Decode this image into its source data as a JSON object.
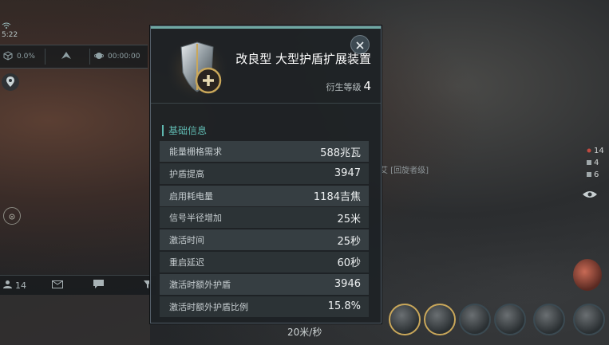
{
  "hud": {
    "time": "5:22",
    "cell1_value": "0.0%",
    "cell3_value": "00:00:00"
  },
  "chat": {
    "members_count": "14"
  },
  "right_counts": [
    "14",
    "4",
    "6"
  ],
  "pilot_label": "艾 [回旋者级]",
  "speed": "20米/秒",
  "panel": {
    "item_name": "改良型 大型护盾扩展装置",
    "level_label": "衍生等级",
    "level_value": "4",
    "section_title": "基础信息",
    "stats": [
      {
        "label": "能量栅格需求",
        "value": "588兆瓦"
      },
      {
        "label": "护盾提高",
        "value": "3947"
      },
      {
        "label": "启用耗电量",
        "value": "1184吉焦"
      },
      {
        "label": "信号半径增加",
        "value": "25米"
      },
      {
        "label": "激活时间",
        "value": "25秒"
      },
      {
        "label": "重启延迟",
        "value": "60秒"
      },
      {
        "label": "激活时额外护盾",
        "value": "3946"
      },
      {
        "label": "激活时额外护盾比例",
        "value": "15.8%"
      }
    ]
  },
  "colors": {
    "accent": "#5fb8b0",
    "panel_bg": "#1e2225",
    "row_odd": "#363e42",
    "row_even": "#2c3336",
    "module_active": "#c9a75a"
  }
}
